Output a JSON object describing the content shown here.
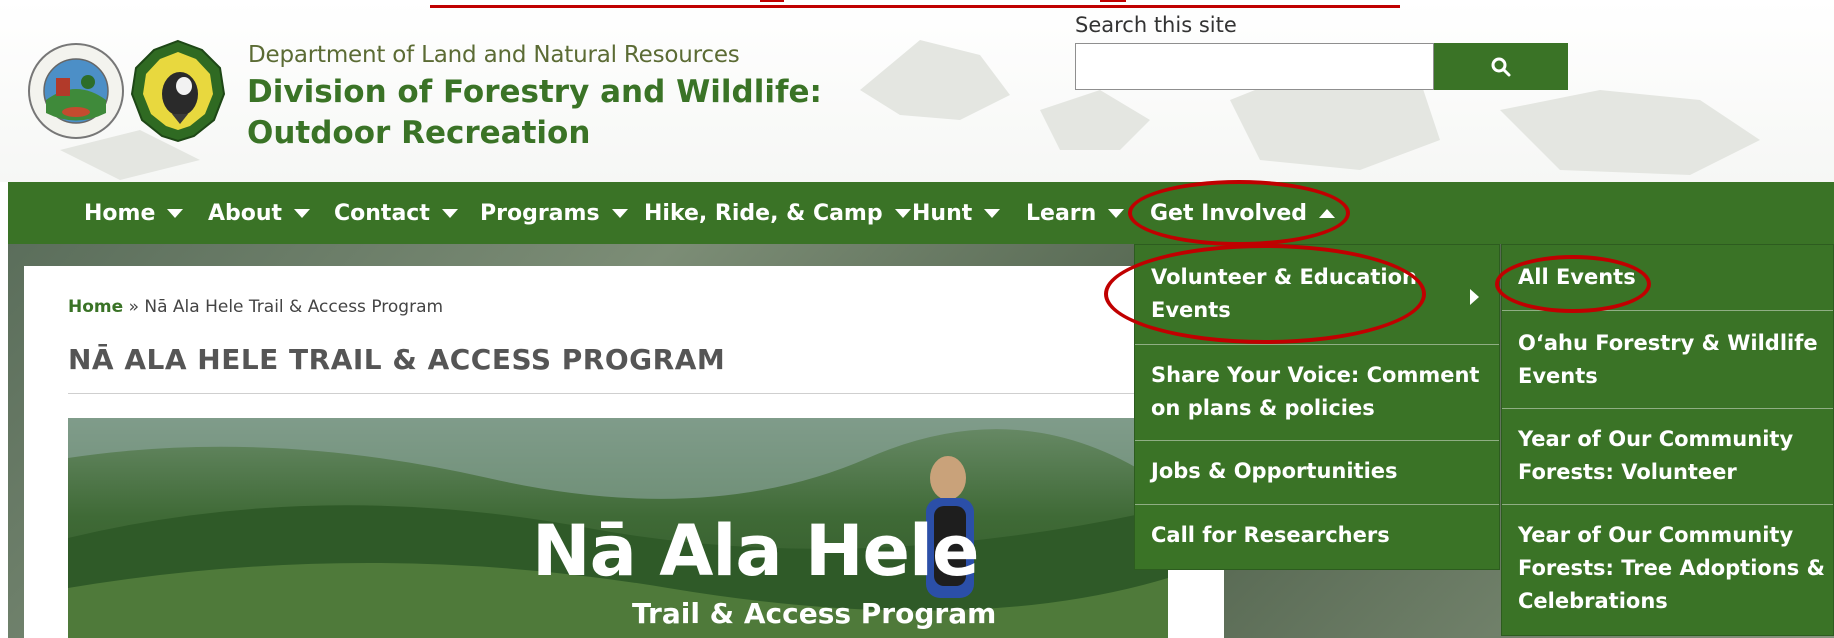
{
  "header": {
    "department": "Department of Land and Natural Resources",
    "division": "Division of Forestry and Wildlife: Outdoor Recreation",
    "logos": [
      "dlnr-seal-logo",
      "dofaw-logo"
    ]
  },
  "search": {
    "label": "Search this site",
    "value": "",
    "button_icon": "search-icon"
  },
  "nav": {
    "items": [
      {
        "label": "Home",
        "caret": "down"
      },
      {
        "label": "About",
        "caret": "down"
      },
      {
        "label": "Contact",
        "caret": "down"
      },
      {
        "label": "Programs",
        "caret": "down"
      },
      {
        "label": "Hike, Ride, & Camp",
        "caret": "down"
      },
      {
        "label": "Hunt",
        "caret": "down"
      },
      {
        "label": "Learn",
        "caret": "down"
      },
      {
        "label": "Get Involved",
        "caret": "up"
      }
    ]
  },
  "get_involved_menu": {
    "items": [
      {
        "label": "Volunteer & Education Events",
        "has_submenu": true
      },
      {
        "label": "Share Your Voice: Comment on plans & policies"
      },
      {
        "label": "Jobs & Opportunities"
      },
      {
        "label": "Call for Researchers"
      }
    ]
  },
  "events_submenu": {
    "items": [
      {
        "label": "All Events"
      },
      {
        "label": "O‘ahu Forestry & Wildlife Events"
      },
      {
        "label": "Year of Our Community Forests: Volunteer"
      },
      {
        "label": "Year of Our Community Forests: Tree Adoptions & Celebrations"
      }
    ]
  },
  "breadcrumb": {
    "home": "Home",
    "separator": "»",
    "current": "Nā Ala Hele Trail & Access Program"
  },
  "page": {
    "title": "NĀ ALA HELE TRAIL & ACCESS PROGRAM"
  },
  "banner": {
    "title": "Nā Ala Hele",
    "subtitle": "Trail & Access Program"
  },
  "colors": {
    "brand_green": "#3a7326",
    "annotation_red": "#c00000"
  }
}
